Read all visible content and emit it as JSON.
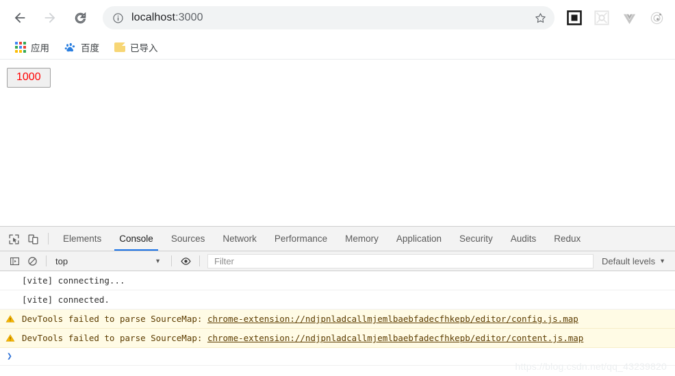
{
  "browser": {
    "nav": {
      "back_title": "Back",
      "forward_title": "Forward",
      "reload_title": "Reload"
    },
    "omnibox": {
      "host": "localhost",
      "port": ":3000",
      "info_icon": "info-circle-icon",
      "bookmark_icon": "star-icon"
    },
    "extensions": [
      {
        "name": "square-extension-icon",
        "label": ""
      },
      {
        "name": "pattern-extension-icon",
        "label": ""
      },
      {
        "name": "vue-devtools-icon",
        "label": ""
      },
      {
        "name": "react-devtools-icon",
        "label": ""
      }
    ],
    "bookmarks": [
      {
        "icon": "apps-grid-icon",
        "label": "应用"
      },
      {
        "icon": "baidu-icon",
        "label": "百度"
      },
      {
        "icon": "folder-icon",
        "label": "已导入"
      }
    ]
  },
  "page": {
    "counter_button_label": "1000",
    "counter_button_color": "#ff0000"
  },
  "devtools": {
    "tools": [
      {
        "name": "inspect-element-icon"
      },
      {
        "name": "device-toolbar-icon"
      }
    ],
    "tabs": [
      {
        "label": "Elements",
        "active": false
      },
      {
        "label": "Console",
        "active": true
      },
      {
        "label": "Sources",
        "active": false
      },
      {
        "label": "Network",
        "active": false
      },
      {
        "label": "Performance",
        "active": false
      },
      {
        "label": "Memory",
        "active": false
      },
      {
        "label": "Application",
        "active": false
      },
      {
        "label": "Security",
        "active": false
      },
      {
        "label": "Audits",
        "active": false
      },
      {
        "label": "Redux",
        "active": false
      }
    ],
    "active_tab_underline_color": "#1a73e8",
    "console_toolbar": {
      "sidebar_icon": "show-console-sidebar-icon",
      "clear_icon": "clear-console-icon",
      "context_value": "top",
      "context_caret": "▼",
      "eye_icon": "live-expression-eye-icon",
      "filter_placeholder": "Filter",
      "filter_value": "",
      "levels_value": "Default levels",
      "levels_caret": "▼"
    },
    "console_messages": [
      {
        "level": "log",
        "text": "[vite] connecting...",
        "link": ""
      },
      {
        "level": "log",
        "text": "[vite] connected.",
        "link": ""
      },
      {
        "level": "warning",
        "icon": "warning-triangle-icon",
        "text": "DevTools failed to parse SourceMap: ",
        "link": "chrome-extension://ndjpnladcallmjemlbaebfadecfhkepb/editor/config.js.map"
      },
      {
        "level": "warning",
        "icon": "warning-triangle-icon",
        "text": "DevTools failed to parse SourceMap: ",
        "link": "chrome-extension://ndjpnladcallmjemlbaebfadecfhkepb/editor/content.js.map"
      }
    ],
    "prompt_symbol": "❯"
  },
  "watermark": "https://blog.csdn.net/qq_43239820"
}
